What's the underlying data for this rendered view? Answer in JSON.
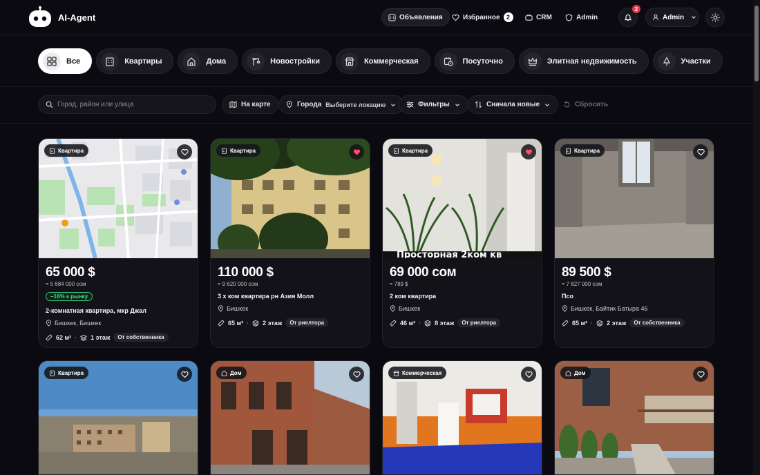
{
  "app": {
    "title": "AI-Agent"
  },
  "nav": {
    "listings": "Объявления",
    "favorites": "Избранное",
    "favorites_count": "2",
    "crm": "CRM",
    "admin": "Admin",
    "notifications_count": "2",
    "user_name": "Admin"
  },
  "categories": [
    {
      "label": "Все",
      "icon": "grid-icon"
    },
    {
      "label": "Квартиры",
      "icon": "building-icon"
    },
    {
      "label": "Дома",
      "icon": "house-icon"
    },
    {
      "label": "Новостройки",
      "icon": "crane-icon"
    },
    {
      "label": "Коммерческая",
      "icon": "store-icon"
    },
    {
      "label": "Посуточно",
      "icon": "calendar-clock-icon"
    },
    {
      "label": "Элитная недвижимость",
      "icon": "crown-icon"
    },
    {
      "label": "Участки",
      "icon": "tree-icon"
    }
  ],
  "filters": {
    "search_placeholder": "Город, район или улица",
    "map": "На карте",
    "city_label": "Города",
    "city_value": "Выберите локацию",
    "filters": "Фильтры",
    "sort": "Сначала новые",
    "reset": "Сбросить"
  },
  "listings": [
    {
      "type": "Квартира",
      "price": "65 000 $",
      "alt_price": "≈ 5 684 000 сом",
      "market": "−16% к рынку",
      "title": "2-комнатная квартира, мкр Джал",
      "location": "Бишкек, Бишкек",
      "area": "62 м²",
      "floor": "1 этаж",
      "seller": "От собственника",
      "favorite": false
    },
    {
      "type": "Квартира",
      "price": "110 000 $",
      "alt_price": "≈ 9 620 000 сом",
      "title": "3 х ком квартира рн Азия Молл",
      "location": "Бишкек",
      "area": "65 м²",
      "floor": "2 этаж",
      "seller": "От риелтора",
      "favorite": true
    },
    {
      "type": "Квартира",
      "price": "69 000 сом",
      "alt_price": "≈ 789 $",
      "title": "2 ком квартира",
      "location": "Бишкек",
      "area": "46 м²",
      "floor": "8 этаж",
      "seller": "От риелтора",
      "favorite": true
    },
    {
      "type": "Квартира",
      "price": "89 500 $",
      "alt_price": "≈ 7 827 000 сом",
      "title": "Псо",
      "location": "Бишкек, Байтик Батыра 46",
      "area": "65 м²",
      "floor": "2 этаж",
      "seller": "От собственника",
      "favorite": false
    },
    {
      "type": "Квартира",
      "favorite": false
    },
    {
      "type": "Дом",
      "favorite": false
    },
    {
      "type": "Коммерческая",
      "favorite": false
    },
    {
      "type": "Дом",
      "favorite": false
    }
  ],
  "image_overlay_text": "Просторная 2ком кв",
  "colors": {
    "background": "#0b0a10",
    "card": "#131218",
    "accent_heart": "#ff4d6a",
    "market_green": "#3ee08a",
    "badge_red": "#e23a4a"
  }
}
